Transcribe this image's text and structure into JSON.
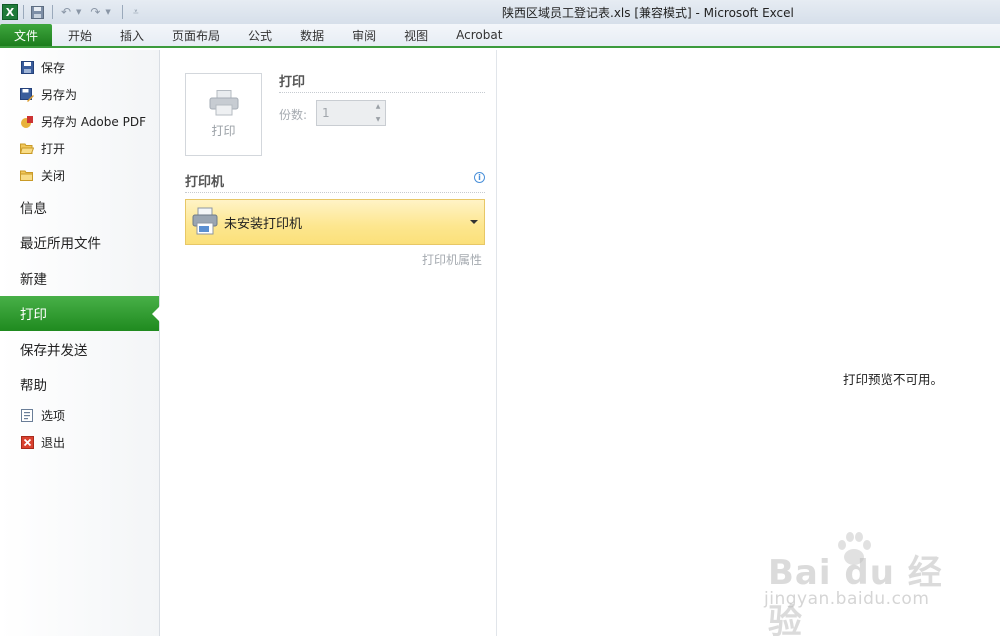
{
  "titlebar": {
    "app_icon": "X",
    "title": "陕西区域员工登记表.xls  [兼容模式]  -  Microsoft Excel"
  },
  "ribbon": {
    "tabs": [
      {
        "label": "文件"
      },
      {
        "label": "开始"
      },
      {
        "label": "插入"
      },
      {
        "label": "页面布局"
      },
      {
        "label": "公式"
      },
      {
        "label": "数据"
      },
      {
        "label": "审阅"
      },
      {
        "label": "视图"
      },
      {
        "label": "Acrobat"
      }
    ]
  },
  "leftnav": {
    "small_top": [
      {
        "label": "保存",
        "icon": "save-icon"
      },
      {
        "label": "另存为",
        "icon": "save-as-icon"
      },
      {
        "label": "另存为 Adobe PDF",
        "icon": "pdf-icon"
      },
      {
        "label": "打开",
        "icon": "open-folder-icon"
      },
      {
        "label": "关闭",
        "icon": "close-folder-icon"
      }
    ],
    "big": [
      {
        "label": "信息"
      },
      {
        "label": "最近所用文件"
      },
      {
        "label": "新建"
      },
      {
        "label": "打印"
      },
      {
        "label": "保存并发送"
      },
      {
        "label": "帮助"
      }
    ],
    "active_item": "打印",
    "small_bottom": [
      {
        "label": "选项",
        "icon": "options-icon"
      },
      {
        "label": "退出",
        "icon": "exit-icon"
      }
    ]
  },
  "print_section": {
    "title": "打印",
    "button_label": "打印",
    "copies_label": "份数:",
    "copies_value": "1"
  },
  "printer_section": {
    "title": "打印机",
    "selected_printer": "未安装打印机",
    "properties_link": "打印机属性"
  },
  "preview": {
    "message": "打印预览不可用。"
  },
  "watermark": {
    "main": "Bai du 经验",
    "sub": "jingyan.baidu.com"
  },
  "colors": {
    "accent_green": "#2e9a2e",
    "printer_select_bg": "#fde68e"
  }
}
